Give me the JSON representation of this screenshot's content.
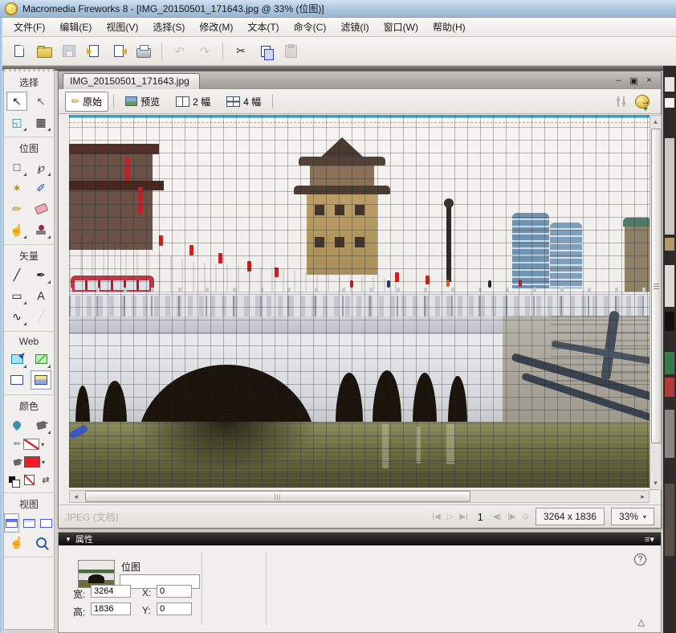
{
  "window": {
    "title": "Macromedia Fireworks 8 - [IMG_20150501_171643.jpg @  33% (位图)]"
  },
  "menu": {
    "items": [
      "文件(F)",
      "编辑(E)",
      "视图(V)",
      "选择(S)",
      "修改(M)",
      "文本(T)",
      "命令(C)",
      "滤镜(I)",
      "窗口(W)",
      "帮助(H)"
    ]
  },
  "toolbar": {
    "icons": [
      "new-document",
      "open",
      "save",
      "import",
      "export",
      "print",
      "undo",
      "redo",
      "cut",
      "copy",
      "paste"
    ]
  },
  "tools": {
    "select": {
      "title": "选择",
      "items": [
        {
          "name": "pointer",
          "glyph": "↖"
        },
        {
          "name": "subselection",
          "glyph": "↖"
        },
        {
          "name": "scale",
          "glyph": "◱"
        },
        {
          "name": "crop",
          "glyph": "▦"
        }
      ]
    },
    "bitmap": {
      "title": "位图",
      "items": [
        {
          "name": "marquee",
          "glyph": "□"
        },
        {
          "name": "lasso",
          "glyph": "℘"
        },
        {
          "name": "magic-wand",
          "glyph": "✶"
        },
        {
          "name": "brush",
          "glyph": "✐"
        },
        {
          "name": "pencil",
          "glyph": "✏"
        },
        {
          "name": "eraser",
          "glyph": ""
        },
        {
          "name": "smudge",
          "glyph": "☝"
        },
        {
          "name": "rubber-stamp",
          "glyph": ""
        }
      ]
    },
    "vector": {
      "title": "矢量",
      "items": [
        {
          "name": "line",
          "glyph": "╱"
        },
        {
          "name": "pen",
          "glyph": "✒"
        },
        {
          "name": "rectangle",
          "glyph": "▭"
        },
        {
          "name": "text",
          "glyph": "A"
        },
        {
          "name": "freeform",
          "glyph": "∿"
        },
        {
          "name": "knife",
          "glyph": "╱"
        }
      ]
    },
    "web": {
      "title": "Web"
    },
    "colors": {
      "title": "颜色"
    },
    "view": {
      "title": "视图"
    }
  },
  "document": {
    "tab": "IMG_20150501_171643.jpg",
    "window_buttons": {
      "minimize": "–",
      "restore": "▣",
      "close": "×"
    },
    "view_modes": {
      "original": "原始",
      "preview": "预览",
      "two_up": "2 幅",
      "four_up": "4 幅"
    },
    "transport": {
      "first": "|◀",
      "play": "▷",
      "last": "▶|",
      "prev": "◀|",
      "next": "|▶",
      "loop": "⊙"
    },
    "status": {
      "format": "JPEG (文档)",
      "frame": "1",
      "dimensions": "3264 x 1836",
      "zoom": "33%",
      "zoom_arrow": "▾"
    }
  },
  "properties": {
    "header": "属性",
    "object_type": "位图",
    "name_value": "",
    "width_label": "宽:",
    "width": "3264",
    "height_label": "高:",
    "height": "1836",
    "x_label": "X:",
    "x": "0",
    "y_label": "Y:",
    "y": "0",
    "help": "?",
    "expand_arrow": "△"
  },
  "colors_info": {
    "fill_swatch": "#ee1c25",
    "stroke_swatch_line": "#d02a2a",
    "quick_export_yellow": "#e4b62e",
    "water_green": "#5d5f38",
    "grid_line": "#3c3c3c"
  }
}
